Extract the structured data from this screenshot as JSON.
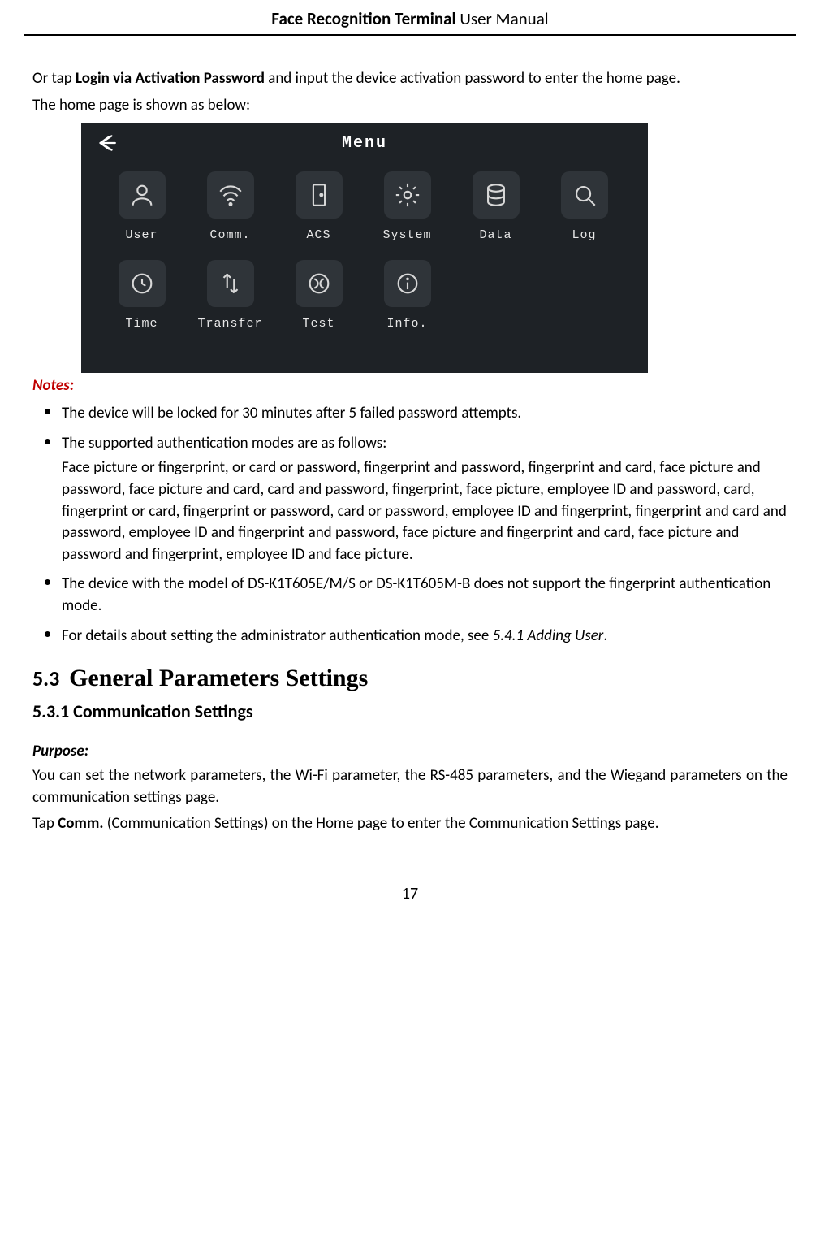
{
  "header": {
    "bold_part": "Face Recognition Terminal",
    "rest": "  User Manual"
  },
  "intro": {
    "line1_prefix": "Or tap ",
    "line1_bold": "Login via Activation Password",
    "line1_suffix": " and input the device activation password to enter the home page.",
    "line2": "The home page is shown as below:"
  },
  "screenshot": {
    "back_label": "Back",
    "title": "Menu",
    "items": [
      {
        "name": "user-icon",
        "label": "User"
      },
      {
        "name": "comm-icon",
        "label": "Comm."
      },
      {
        "name": "acs-icon",
        "label": "ACS"
      },
      {
        "name": "system-icon",
        "label": "System"
      },
      {
        "name": "data-icon",
        "label": "Data"
      },
      {
        "name": "log-icon",
        "label": "Log"
      },
      {
        "name": "time-icon",
        "label": "Time"
      },
      {
        "name": "transfer-icon",
        "label": "Transfer"
      },
      {
        "name": "test-icon",
        "label": "Test"
      },
      {
        "name": "info-icon",
        "label": "Info."
      }
    ]
  },
  "notes": {
    "heading": "Notes:",
    "items": [
      {
        "main": "The device will be locked for 30 minutes after 5 failed password attempts."
      },
      {
        "main": "The supported authentication modes are as follows:",
        "sub": "Face picture or fingerprint, or card or password, fingerprint and password, fingerprint and card, face picture and password, face picture and card, card and password, fingerprint, face picture, employee ID and password, card, fingerprint or card, fingerprint or password, card or password, employee ID and fingerprint, fingerprint and card and password, employee ID and fingerprint and password, face picture and fingerprint and card, face picture and password and fingerprint, employee ID and face picture."
      },
      {
        "main": "The device with the model of DS-K1T605E/M/S or DS-K1T605M-B does not support the fingerprint authentication mode."
      },
      {
        "main_prefix": "For details about setting the administrator authentication mode, see ",
        "main_italic": "5.4.1 Adding User",
        "main_suffix": "."
      }
    ]
  },
  "sections": {
    "h2_num": "5.3",
    "h2_text": "General Parameters Settings",
    "h3": "5.3.1   Communication Settings",
    "purpose_heading": "Purpose:",
    "purpose_body": "You can set the network parameters, the Wi-Fi parameter, the RS-485 parameters, and the Wiegand parameters on the communication settings page.",
    "tap_prefix": "Tap ",
    "tap_bold": "Comm.",
    "tap_suffix": " (Communication Settings) on the Home page to enter the Communication Settings page."
  },
  "page_number": "17"
}
